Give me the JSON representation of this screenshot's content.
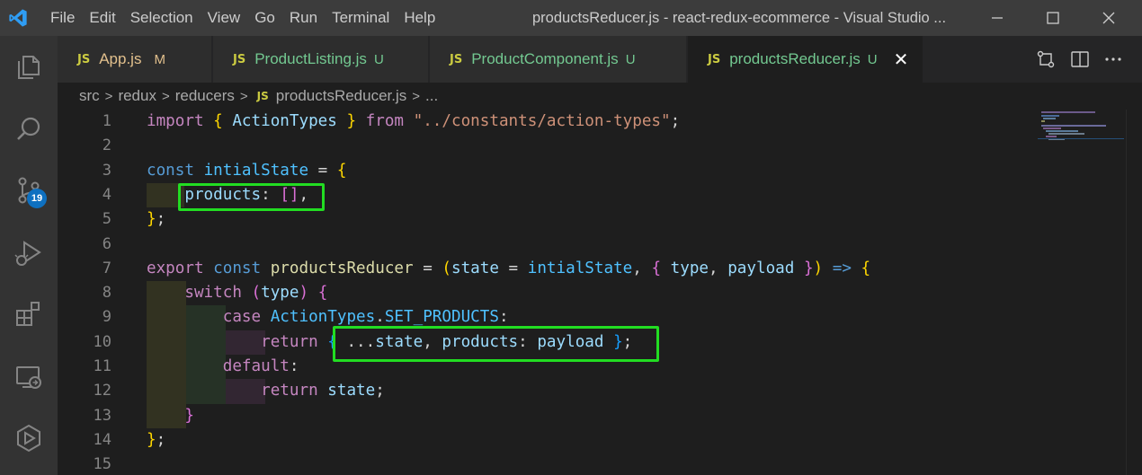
{
  "titlebar": {
    "menu": [
      "File",
      "Edit",
      "Selection",
      "View",
      "Go",
      "Run",
      "Terminal",
      "Help"
    ],
    "window_title": "productsReducer.js - react-redux-ecommerce - Visual Studio ...",
    "icons": [
      "vscode-logo-icon",
      "minimize-icon",
      "maximize-icon",
      "close-icon"
    ]
  },
  "activitybar": {
    "items": [
      "explorer-icon",
      "search-icon",
      "source-control-icon",
      "run-debug-icon",
      "extensions-icon",
      "remote-explorer-icon",
      "docker-icon"
    ],
    "source_control_badge": "19"
  },
  "tabs": [
    {
      "icon": "JS",
      "label": "App.js",
      "status": "M",
      "active": false
    },
    {
      "icon": "JS",
      "label": "ProductListing.js",
      "status": "U",
      "active": false
    },
    {
      "icon": "JS",
      "label": "ProductComponent.js",
      "status": "U",
      "active": false
    },
    {
      "icon": "JS",
      "label": "productsReducer.js",
      "status": "U",
      "active": true
    }
  ],
  "tab_actions": [
    "open-changes-icon",
    "split-editor-icon",
    "more-actions-icon"
  ],
  "breadcrumb": {
    "parts": [
      "src",
      "redux",
      "reducers"
    ],
    "file_icon": "JS",
    "file": "productsReducer.js",
    "tail": "..."
  },
  "editor": {
    "line_numbers": [
      "1",
      "2",
      "3",
      "4",
      "5",
      "6",
      "7",
      "8",
      "9",
      "10",
      "11",
      "12",
      "13",
      "14",
      "15"
    ],
    "code": {
      "l1": {
        "import": "import",
        "ob": "{",
        "name": "ActionTypes",
        "cb": "}",
        "from": "from",
        "path": "\"../constants/action-types\"",
        "semi": ";"
      },
      "l3": {
        "const": "const",
        "name": "intialState",
        "eq": " = ",
        "ob": "{"
      },
      "l4": {
        "prop": "products",
        "colon": ": ",
        "arr": "[]",
        "comma": ","
      },
      "l5": {
        "cb": "}",
        "semi": ";"
      },
      "l7": {
        "export": "export",
        "const": "const",
        "name": "productsReducer",
        "eq": " = ",
        "op": "(",
        "state": "state",
        "eq2": " = ",
        "init": "intialState",
        "comma": ", ",
        "ob": "{",
        "type": "type",
        "comma2": ", ",
        "payload": "payload",
        "cb": "}",
        "cp": ")",
        "arrow": "=>",
        "ob2": "{"
      },
      "l8": {
        "switch": "switch",
        "op": "(",
        "type": "type",
        "cp": ")",
        "ob": "{"
      },
      "l9": {
        "case": "case",
        "ns": "ActionTypes",
        "dot": ".",
        "member": "SET_PRODUCTS",
        "colon": ":"
      },
      "l10": {
        "return": "return",
        "ob": "{",
        "spread": "...",
        "state": "state",
        "comma": ", ",
        "prop": "products",
        "colon": ": ",
        "payload": "payload",
        "cb": "}",
        "semi": ";"
      },
      "l11": {
        "default": "default",
        "colon": ":"
      },
      "l12": {
        "return": "return",
        "state": "state",
        "semi": ";"
      },
      "l13": {
        "cb": "}"
      },
      "l14": {
        "cb": "}",
        "semi": ";"
      }
    }
  },
  "colors": {
    "keyword": "#569cd6",
    "control": "#c586c0",
    "variable": "#9cdcfe",
    "constant": "#4fc1ff",
    "string": "#ce9178",
    "highlight_box": "#22dd22",
    "badge": "#0e70c0"
  }
}
